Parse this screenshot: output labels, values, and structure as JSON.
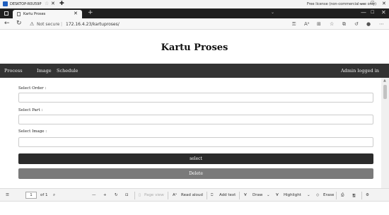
{
  "window": {
    "app_name": "DESKTOP-R0U59P",
    "license_text": "Free license (non-commercial use only)",
    "min_glyph": "—",
    "max_glyph": "☐",
    "close_glyph": "✕"
  },
  "browser": {
    "tab_title": "Kartu Proses",
    "tab_close": "✕",
    "new_tab": "+",
    "not_secure": "Not secure",
    "url": "172.16.4.23/kartuproses/",
    "divider": "|"
  },
  "site": {
    "title": "Kartu Proses",
    "nav": [
      "Process",
      "Image",
      "Schedule"
    ],
    "admin_status": "Admin logged in"
  },
  "form": {
    "order_label": "Select Order :",
    "part_label": "Select Part :",
    "image_label": "Select Image :",
    "select_button": "select",
    "delete_button": "Delete"
  },
  "pdf_toolbar": {
    "page_number": "1",
    "page_of": "of 1",
    "page_view": "Page view",
    "read_aloud": "Read aloud",
    "add_text": "Add text",
    "draw": "Draw",
    "highlight": "Highlight",
    "erase": "Erase"
  }
}
